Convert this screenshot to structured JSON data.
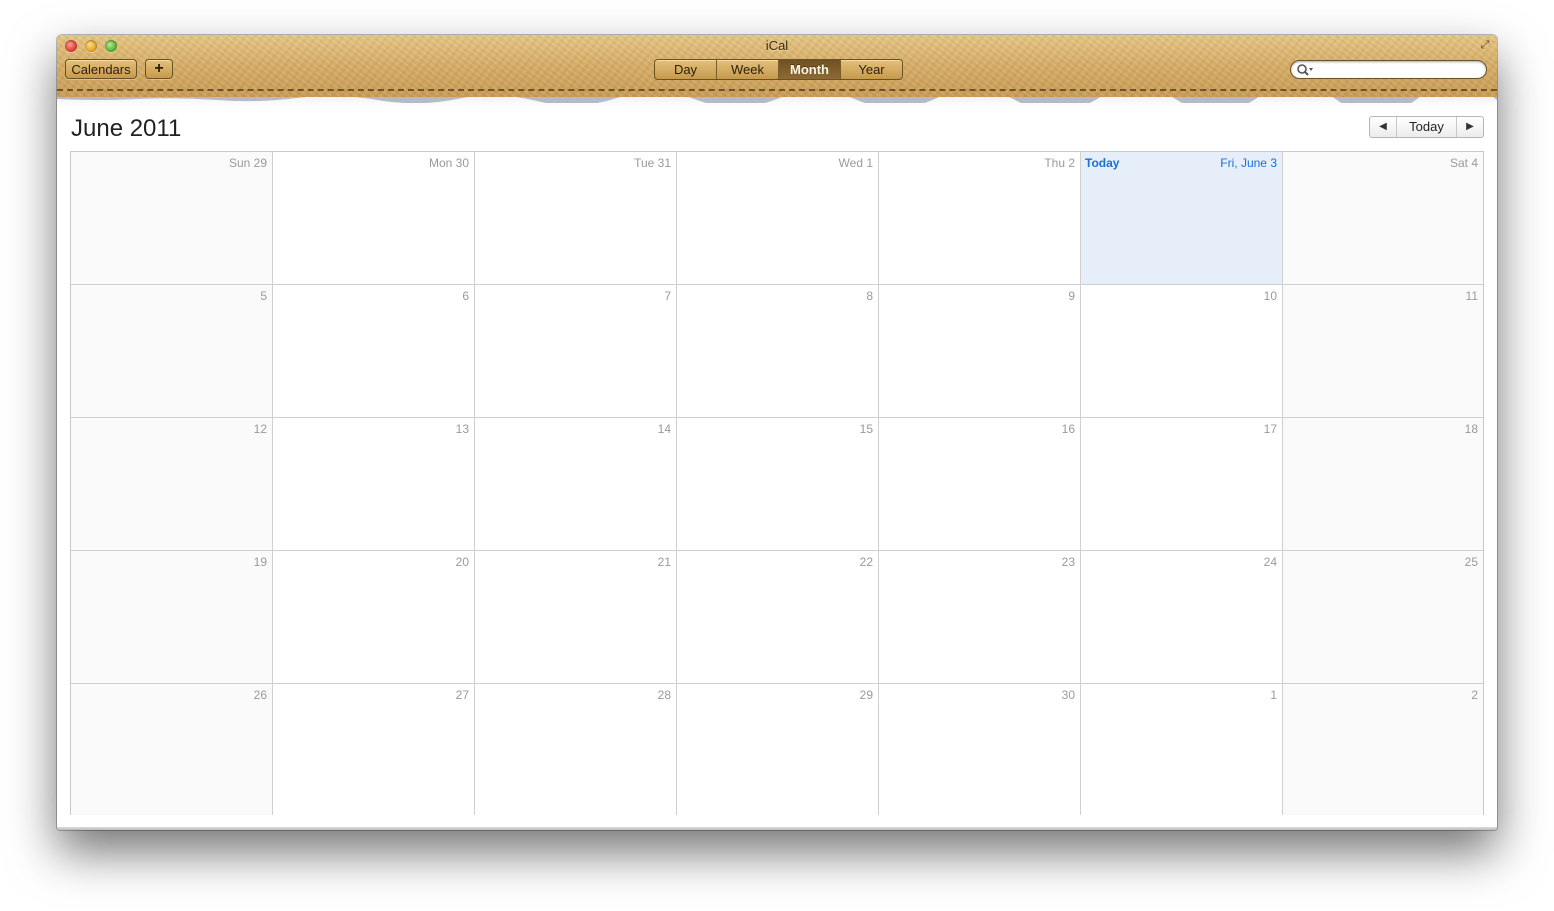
{
  "window": {
    "title": "iCal"
  },
  "toolbar": {
    "calendars_label": "Calendars",
    "add_label": "+",
    "views": [
      {
        "label": "Day",
        "selected": false
      },
      {
        "label": "Week",
        "selected": false
      },
      {
        "label": "Month",
        "selected": true
      },
      {
        "label": "Year",
        "selected": false
      }
    ],
    "search": {
      "value": "",
      "placeholder": ""
    }
  },
  "header": {
    "month_title": "June 2011",
    "nav": {
      "prev_icon": "triangle-left-icon",
      "today_label": "Today",
      "next_icon": "triangle-right-icon"
    }
  },
  "calendar": {
    "today_tag": "Today",
    "rows": [
      [
        "Sun 29",
        "Mon 30",
        "Tue 31",
        "Wed 1",
        "Thu 2",
        "Fri, June 3",
        "Sat 4"
      ],
      [
        "5",
        "6",
        "7",
        "8",
        "9",
        "10",
        "11"
      ],
      [
        "12",
        "13",
        "14",
        "15",
        "16",
        "17",
        "18"
      ],
      [
        "19",
        "20",
        "21",
        "22",
        "23",
        "24",
        "25"
      ],
      [
        "26",
        "27",
        "28",
        "29",
        "30",
        "1",
        "2"
      ]
    ],
    "today_position": {
      "row": 0,
      "col": 5
    }
  },
  "colors": {
    "accent_today": "#1a6fd6",
    "today_bg": "#e6eef9",
    "leather": "#d9b06a"
  }
}
